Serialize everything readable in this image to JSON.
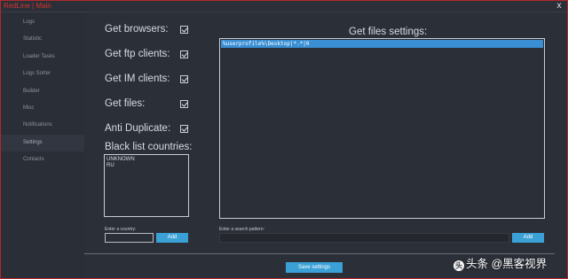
{
  "window": {
    "title": "RedLine | Main",
    "close_glyph": "x"
  },
  "sidebar": {
    "items": [
      {
        "label": "Logs"
      },
      {
        "label": "Statistic"
      },
      {
        "label": "Loader Tasks"
      },
      {
        "label": "Logs Sorter"
      },
      {
        "label": "Builder"
      },
      {
        "label": "Misc"
      },
      {
        "label": "Notifications"
      },
      {
        "label": "Settings",
        "active": true
      },
      {
        "label": "Contacts"
      }
    ]
  },
  "options": {
    "get_browsers": {
      "label": "Get browsers:",
      "checked": true
    },
    "get_ftp": {
      "label": "Get ftp clients:",
      "checked": true
    },
    "get_im": {
      "label": "Get IM clients:",
      "checked": true
    },
    "get_files": {
      "label": "Get files:",
      "checked": true
    },
    "anti_duplicate": {
      "label": "Anti Duplicate:",
      "checked": true
    }
  },
  "blacklist": {
    "title": "Black list countries:",
    "countries": [
      "UNKNOWN",
      "RU"
    ],
    "input_label": "Enter a country:",
    "input_value": "",
    "add_label": "Add"
  },
  "files": {
    "title": "Get files settings:",
    "patterns": [
      "%userprofile%\\Desktop|*.*|0"
    ],
    "input_label": "Enter a search pattern:",
    "input_value": "",
    "add_label": "Add"
  },
  "footer": {
    "save_label": "Save settings"
  },
  "watermark": {
    "mark": "头",
    "text": "头条 @黑客视界"
  },
  "colors": {
    "accent": "#3aa0d6",
    "selection": "#3a8fd4",
    "title_red": "#d4342f",
    "background": "#2b2f38"
  }
}
